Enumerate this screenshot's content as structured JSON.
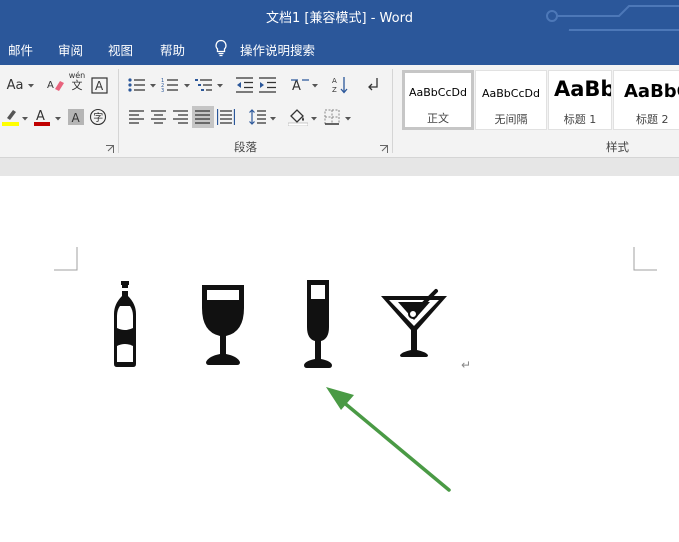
{
  "titlebar": {
    "title": "文档1 [兼容模式] - Word"
  },
  "tabs": [
    {
      "label": "邮件"
    },
    {
      "label": "审阅"
    },
    {
      "label": "视图"
    },
    {
      "label": "帮助"
    }
  ],
  "tell_me": {
    "label": "操作说明搜索",
    "icon": "lightbulb-icon"
  },
  "ribbon": {
    "font_group": {
      "change_case_label": "Aa",
      "phonetic_top": "wén",
      "phonetic_bottom": "文"
    },
    "paragraph_group": {
      "label": "段落"
    },
    "styles_group": {
      "label": "样式",
      "styles": [
        {
          "sample": "AaBbCcDd",
          "name": "正文"
        },
        {
          "sample": "AaBbCcDd",
          "name": "无间隔"
        },
        {
          "sample": "AaBb",
          "name": "标题 1"
        },
        {
          "sample": "AaBbC",
          "name": "标题 2"
        }
      ]
    }
  },
  "document": {
    "symbols": [
      "bottle-icon",
      "wine-glass-icon",
      "champagne-flute-icon",
      "cocktail-glass-icon"
    ],
    "paragraph_mark": "↵"
  },
  "colors": {
    "title_blue": "#2b579a",
    "highlight_yellow": "#ffff00",
    "font_color_red": "#c00000",
    "arrow_green": "#4a9a45"
  }
}
